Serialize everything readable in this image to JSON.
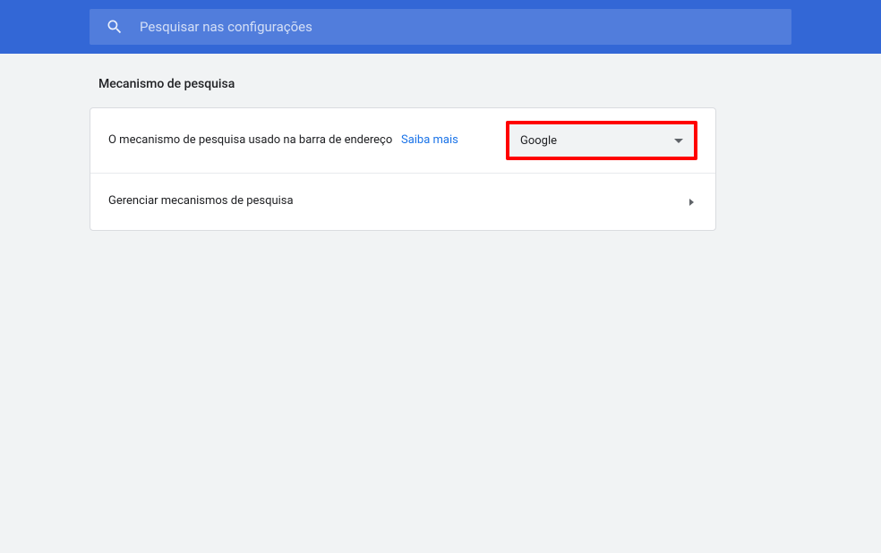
{
  "header": {
    "search_placeholder": "Pesquisar nas configurações"
  },
  "section": {
    "title": "Mecanismo de pesquisa",
    "row1": {
      "label": "O mecanismo de pesquisa usado na barra de endereço",
      "learn_more": "Saiba mais",
      "selected": "Google"
    },
    "row2": {
      "label": "Gerenciar mecanismos de pesquisa"
    }
  }
}
